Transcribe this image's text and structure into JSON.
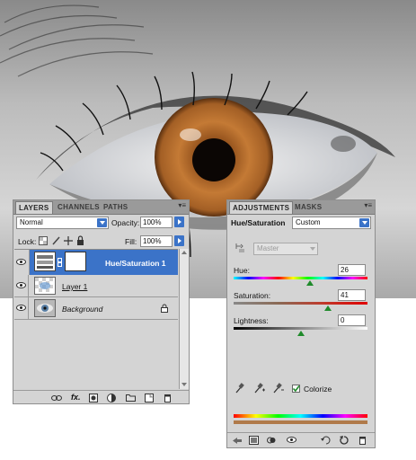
{
  "photo": {
    "description_icon": "eye-photo"
  },
  "layers_panel": {
    "tabs": [
      "LAYERS",
      "CHANNELS",
      "PATHS"
    ],
    "blend_mode": "Normal",
    "opacity_label": "Opacity:",
    "opacity_value": "100%",
    "lock_label": "Lock:",
    "fill_label": "Fill:",
    "fill_value": "100%",
    "layers": [
      {
        "name": "Hue/Saturation 1",
        "selected": true,
        "icon": "adjustment-layer-icon"
      },
      {
        "name": "Layer 1",
        "selected": false,
        "icon": "layer-thumbnail"
      },
      {
        "name": "Background",
        "selected": false,
        "icon": "background-thumbnail"
      }
    ],
    "bottom_icons": [
      "link-layers-icon",
      "fx-icon",
      "layer-mask-icon",
      "adjustment-icon",
      "group-icon",
      "new-layer-icon",
      "trash-icon"
    ],
    "fx_label": "fx."
  },
  "adjustments_panel": {
    "tabs": [
      "ADJUSTMENTS",
      "MASKS"
    ],
    "title": "Hue/Saturation",
    "preset": "Custom",
    "channel": "Master",
    "hue_label": "Hue:",
    "hue_value": "26",
    "saturation_label": "Saturation:",
    "saturation_value": "41",
    "lightness_label": "Lightness:",
    "lightness_value": "0",
    "colorize_label": "Colorize",
    "colorize_checked": true,
    "slider_levels": {
      "hue": 26,
      "hue_range": [
        -180,
        180
      ],
      "saturation": 41,
      "saturation_range": [
        -100,
        100
      ],
      "lightness": 0,
      "lightness_range": [
        -100,
        100
      ]
    },
    "colors": {
      "accent": "#3b73c8",
      "thumb": "#1f8a2a",
      "colorize_tone": "#b07a4a"
    }
  }
}
